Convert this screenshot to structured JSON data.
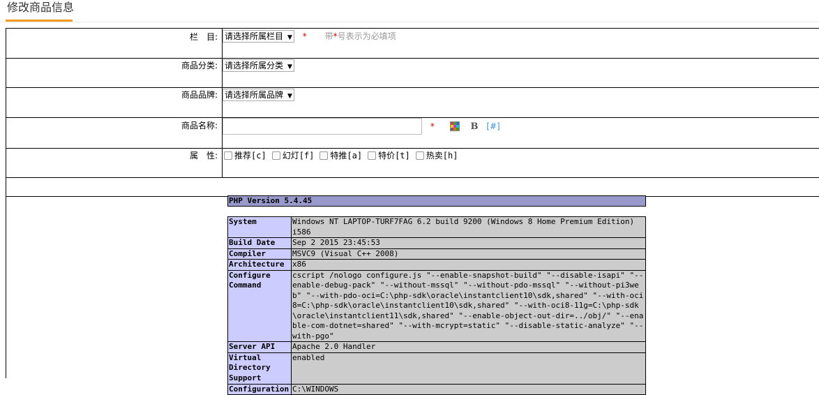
{
  "page": {
    "title": "修改商品信息"
  },
  "form": {
    "column": {
      "label": "栏　目:",
      "select": "请选择所属栏目",
      "required": "*",
      "hint_prefix": "带",
      "hint_star": "*",
      "hint_suffix": "号表示为必填项"
    },
    "category": {
      "label": "商品分类:",
      "select": "请选择所属分类"
    },
    "brand": {
      "label": "商品品牌:",
      "select": "请选择所属品牌"
    },
    "name": {
      "label": "商品名称:",
      "value": "",
      "required": "*",
      "bold": "B",
      "link": "[#]"
    },
    "attrs": {
      "label": "属　性:",
      "items": [
        "推荐[c]",
        "幻灯[f]",
        "特推[a]",
        "特价[t]",
        "热卖[h]"
      ]
    }
  },
  "phpinfo": {
    "header": "PHP Version 5.4.45",
    "rows": [
      {
        "key": "System",
        "value": "Windows NT LAPTOP-TURF7FAG 6.2 build 9200 (Windows 8 Home Premium Edition) i586"
      },
      {
        "key": "Build Date",
        "value": "Sep 2 2015 23:45:53"
      },
      {
        "key": "Compiler",
        "value": "MSVC9 (Visual C++ 2008)"
      },
      {
        "key": "Architecture",
        "value": "x86"
      },
      {
        "key": "Configure Command",
        "value": "cscript /nologo configure.js \"--enable-snapshot-build\" \"--disable-isapi\" \"--enable-debug-pack\" \"--without-mssql\" \"--without-pdo-mssql\" \"--without-pi3web\" \"--with-pdo-oci=C:\\php-sdk\\oracle\\instantclient10\\sdk,shared\" \"--with-oci8=C:\\php-sdk\\oracle\\instantclient10\\sdk,shared\" \"--with-oci8-11g=C:\\php-sdk\\oracle\\instantclient11\\sdk,shared\" \"--enable-object-out-dir=../obj/\" \"--enable-com-dotnet=shared\" \"--with-mcrypt=static\" \"--disable-static-analyze\" \"--with-pgo\""
      },
      {
        "key": "Server API",
        "value": "Apache 2.0 Handler"
      },
      {
        "key": "Virtual Directory Support",
        "value": "enabled"
      },
      {
        "key": "Configuration",
        "value": "C:\\WINDOWS"
      }
    ]
  }
}
